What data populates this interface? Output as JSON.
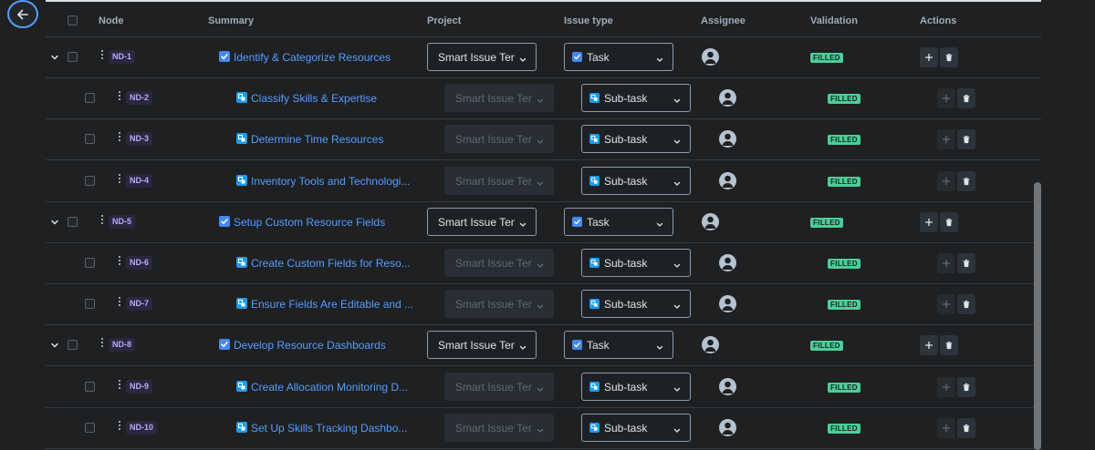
{
  "header": {
    "node": "Node",
    "summary": "Summary",
    "project": "Project",
    "issue_type": "Issue type",
    "assignee": "Assignee",
    "validation": "Validation",
    "actions": "Actions"
  },
  "colors": {
    "accent": "#579dff",
    "task_icon": "#4688ec",
    "subtask_icon": "#1d9aef",
    "filled_badge": "#4bce97",
    "node_badge_text": "#b8acf6"
  },
  "rows": [
    {
      "level": 0,
      "node": "ND-1",
      "summary": "Identify & Categorize Resources",
      "project": "Smart Issue Ten",
      "issue_type": "Task",
      "validation": "FILLED"
    },
    {
      "level": 1,
      "node": "ND-2",
      "summary": "Classify Skills & Expertise",
      "project": "Smart Issue Ten",
      "issue_type": "Sub-task",
      "validation": "FILLED"
    },
    {
      "level": 1,
      "node": "ND-3",
      "summary": "Determine Time Resources",
      "project": "Smart Issue Ten",
      "issue_type": "Sub-task",
      "validation": "FILLED"
    },
    {
      "level": 1,
      "node": "ND-4",
      "summary": "Inventory Tools and Technologi...",
      "project": "Smart Issue Ten",
      "issue_type": "Sub-task",
      "validation": "FILLED"
    },
    {
      "level": 0,
      "node": "ND-5",
      "summary": "Setup Custom Resource Fields",
      "project": "Smart Issue Ten",
      "issue_type": "Task",
      "validation": "FILLED"
    },
    {
      "level": 1,
      "node": "ND-6",
      "summary": "Create Custom Fields for Reso...",
      "project": "Smart Issue Ten",
      "issue_type": "Sub-task",
      "validation": "FILLED"
    },
    {
      "level": 1,
      "node": "ND-7",
      "summary": "Ensure Fields Are Editable and ...",
      "project": "Smart Issue Ten",
      "issue_type": "Sub-task",
      "validation": "FILLED"
    },
    {
      "level": 0,
      "node": "ND-8",
      "summary": "Develop Resource Dashboards",
      "project": "Smart Issue Ten",
      "issue_type": "Task",
      "validation": "FILLED"
    },
    {
      "level": 1,
      "node": "ND-9",
      "summary": "Create Allocation Monitoring D...",
      "project": "Smart Issue Ten",
      "issue_type": "Sub-task",
      "validation": "FILLED"
    },
    {
      "level": 1,
      "node": "ND-10",
      "summary": "Set Up Skills Tracking Dashbo...",
      "project": "Smart Issue Ten",
      "issue_type": "Sub-task",
      "validation": "FILLED"
    }
  ]
}
